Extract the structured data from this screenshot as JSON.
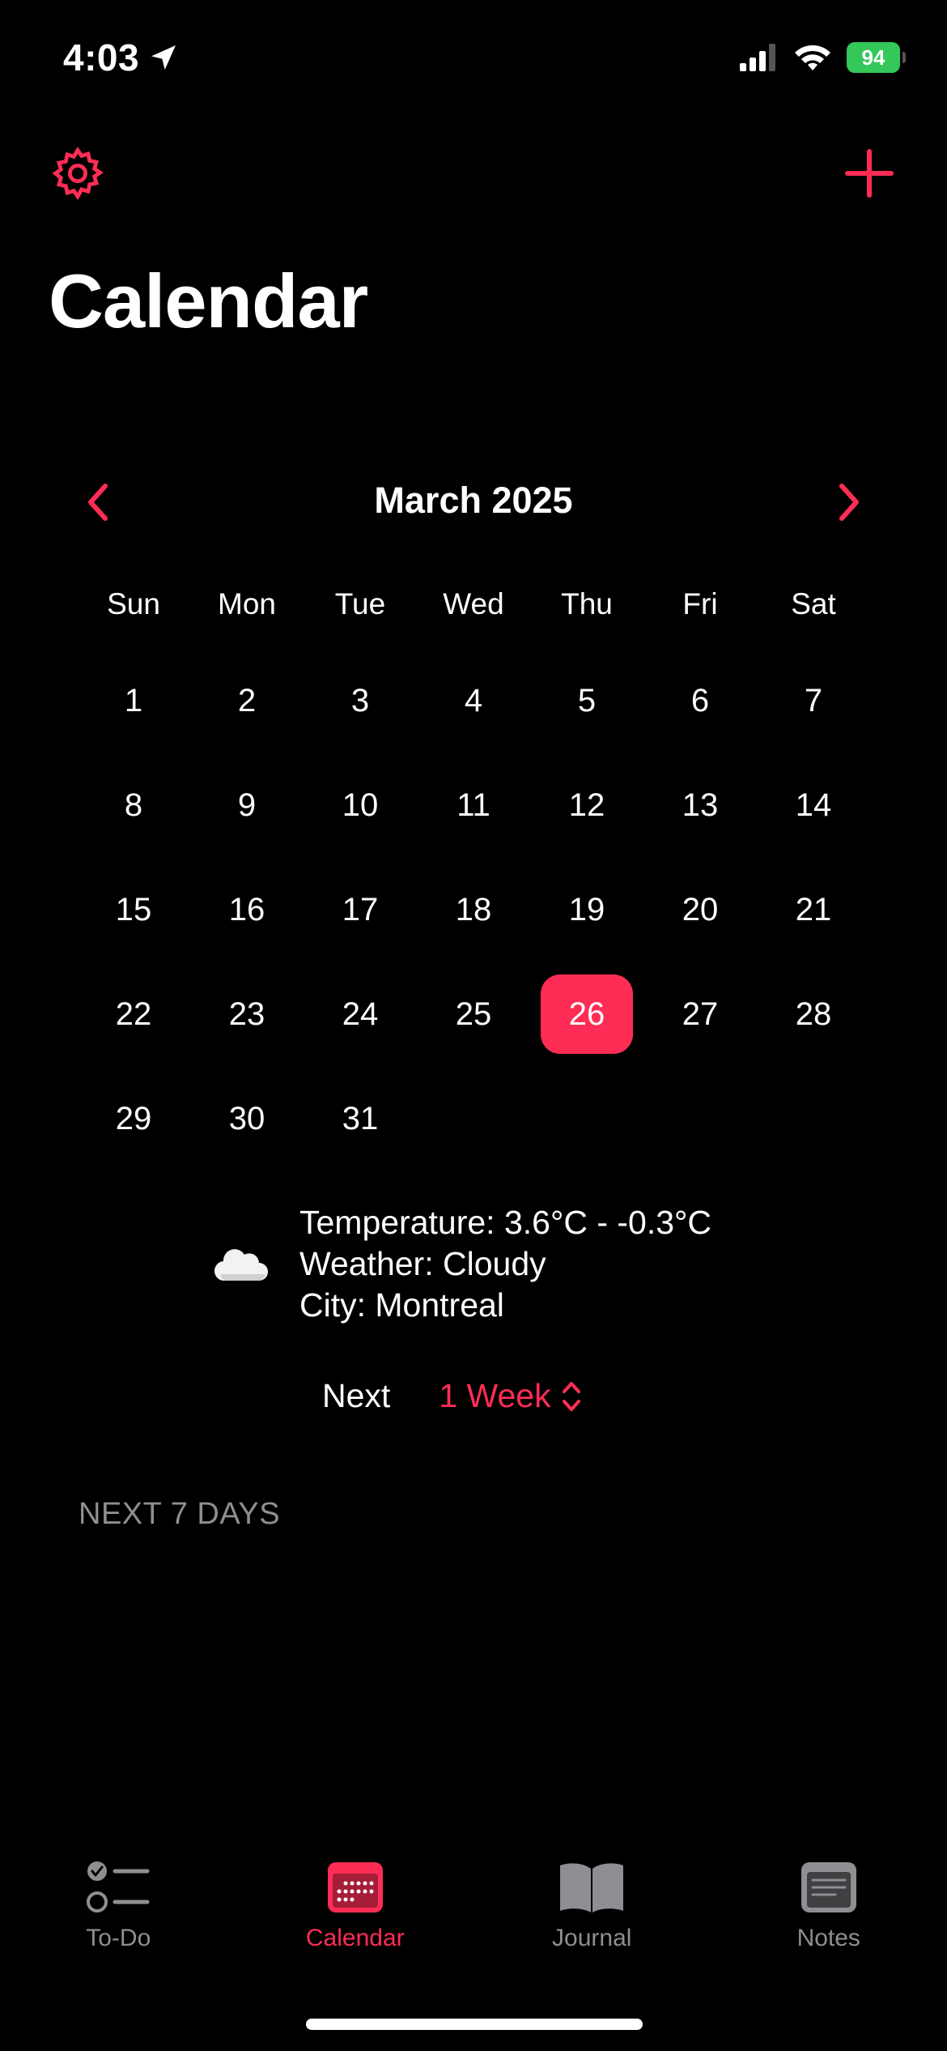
{
  "status": {
    "time": "4:03",
    "battery": "94"
  },
  "header": {
    "title": "Calendar",
    "settings_icon": "gear-icon",
    "add_icon": "plus-icon",
    "accent_color": "#ff2d55"
  },
  "month": {
    "label": "March 2025",
    "weekdays": [
      "Sun",
      "Mon",
      "Tue",
      "Wed",
      "Thu",
      "Fri",
      "Sat"
    ],
    "days": [
      "1",
      "2",
      "3",
      "4",
      "5",
      "6",
      "7",
      "8",
      "9",
      "10",
      "11",
      "12",
      "13",
      "14",
      "15",
      "16",
      "17",
      "18",
      "19",
      "20",
      "21",
      "22",
      "23",
      "24",
      "25",
      "26",
      "27",
      "28",
      "29",
      "30",
      "31"
    ],
    "selected_day": "26"
  },
  "weather": {
    "icon": "cloud-icon",
    "temperature": "Temperature: 3.6°C - -0.3°C",
    "condition": "Weather: Cloudy",
    "city": "City: Montreal"
  },
  "range": {
    "label": "Next",
    "value": "1 Week"
  },
  "section": {
    "label": "NEXT 7 DAYS"
  },
  "tabs": [
    {
      "label": "To-Do",
      "icon": "checklist-icon",
      "active": false
    },
    {
      "label": "Calendar",
      "icon": "calendar-icon",
      "active": true
    },
    {
      "label": "Journal",
      "icon": "book-icon",
      "active": false
    },
    {
      "label": "Notes",
      "icon": "notes-icon",
      "active": false
    }
  ]
}
